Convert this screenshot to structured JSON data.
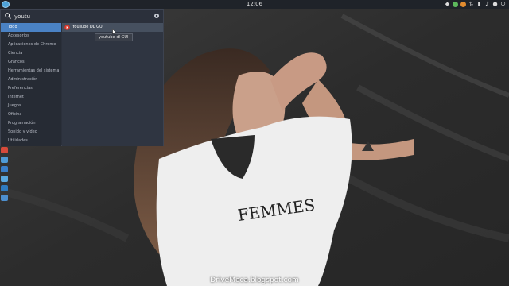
{
  "topbar": {
    "clock": "12:06",
    "tray_icons": [
      "dropbox-icon",
      "chrome-icon",
      "app-icon",
      "network-icon",
      "battery-icon",
      "volume-icon",
      "notification-icon",
      "power-icon"
    ]
  },
  "launcher": {
    "search": {
      "value": "youtu",
      "placeholder": ""
    },
    "categories": [
      "Todo",
      "Accesorios",
      "Aplicaciones de Chrome",
      "Ciencia",
      "Gráficos",
      "Herramientas del sistema",
      "Administración",
      "Preferencias",
      "Internet",
      "Juegos",
      "Oficina",
      "Programación",
      "Sonido y vídeo",
      "Utilidades"
    ],
    "active_category": "Todo",
    "results": [
      {
        "label": "YouTube DL GUI",
        "icon": "youtube-dl-icon"
      }
    ],
    "tooltip": "youtube-dl GUI"
  },
  "watermark": "DriveMeca.blogspot.com",
  "colors": {
    "panel": "#1f2329",
    "launcher_bg": "#2b303b",
    "category_active": "#4a82c4",
    "result_hover": "#46505f"
  }
}
